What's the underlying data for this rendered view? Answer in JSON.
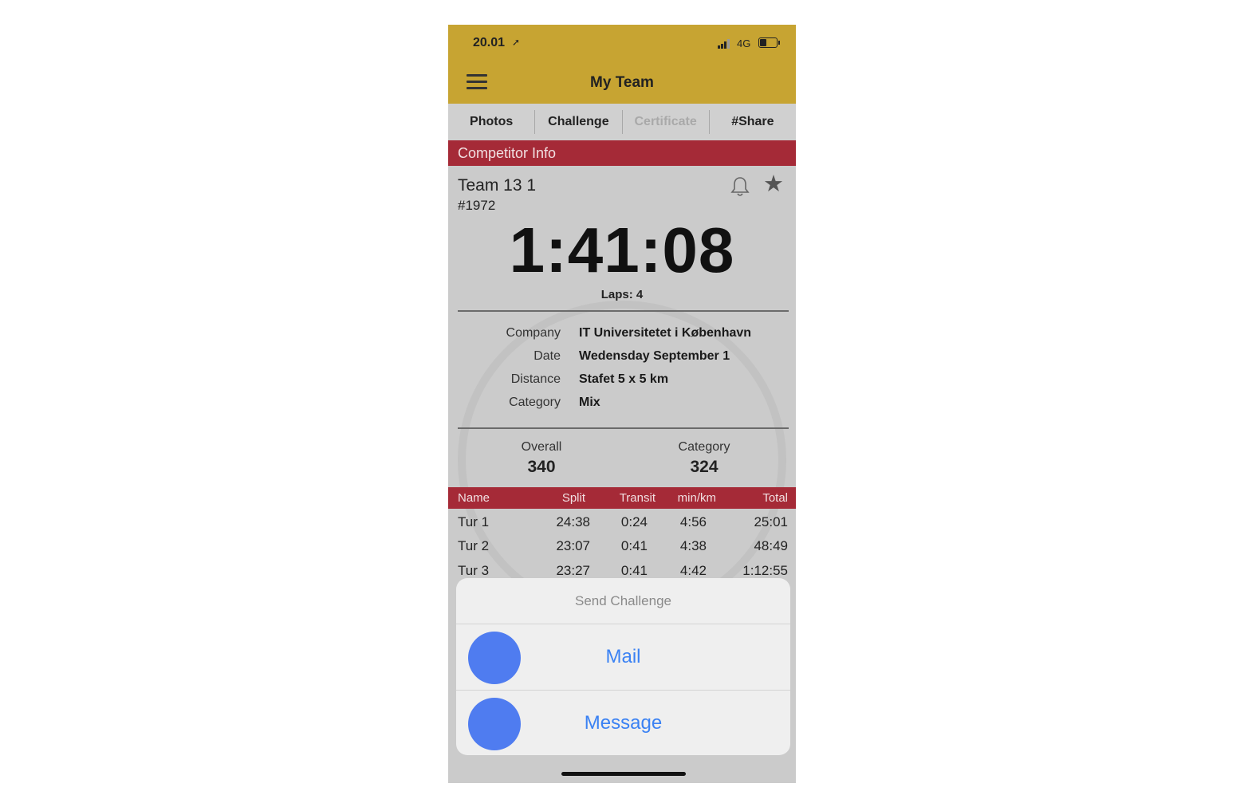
{
  "status": {
    "time": "20.01",
    "network": "4G"
  },
  "nav": {
    "title": "My Team"
  },
  "tabs": [
    {
      "label": "Photos",
      "enabled": true
    },
    {
      "label": "Challenge",
      "enabled": true
    },
    {
      "label": "Certificate",
      "enabled": false
    },
    {
      "label": "#Share",
      "enabled": true
    }
  ],
  "competitor": {
    "section_title": "Competitor Info",
    "team_name": "Team 13 1",
    "team_number": "#1972",
    "time": "1:41:08",
    "laps": "Laps: 4",
    "details": [
      {
        "label": "Company",
        "value": "IT Universitetet i København"
      },
      {
        "label": "Date",
        "value": "Wedensday September 1"
      },
      {
        "label": "Distance",
        "value": "Stafet 5 x 5 km"
      },
      {
        "label": "Category",
        "value": "Mix"
      }
    ],
    "overall_label": "Overall",
    "overall_value": "340",
    "category_label": "Category",
    "category_value": "324"
  },
  "splits": {
    "headers": {
      "name": "Name",
      "split": "Split",
      "transit": "Transit",
      "pace": "min/km",
      "total": "Total"
    },
    "rows": [
      {
        "name": "Tur 1",
        "split": "24:38",
        "transit": "0:24",
        "pace": "4:56",
        "total": "25:01"
      },
      {
        "name": "Tur 2",
        "split": "23:07",
        "transit": "0:41",
        "pace": "4:38",
        "total": "48:49"
      },
      {
        "name": "Tur 3",
        "split": "23:27",
        "transit": "0:41",
        "pace": "4:42",
        "total": "1:12:55"
      }
    ]
  },
  "share_sheet": {
    "title": "Send Challenge",
    "options": [
      {
        "label": "Mail"
      },
      {
        "label": "Message"
      }
    ]
  }
}
